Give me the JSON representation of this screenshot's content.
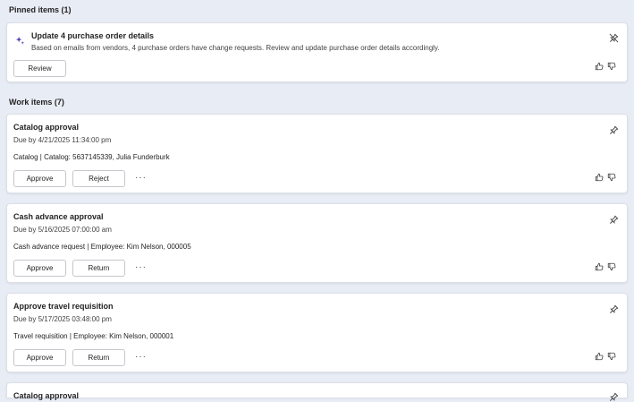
{
  "pinned": {
    "heading": "Pinned items (1)",
    "item": {
      "title": "Update 4 purchase order details",
      "description": "Based on emails from vendors, 4 purchase orders have change requests. Review and update purchase order details accordingly.",
      "review_label": "Review"
    }
  },
  "work": {
    "heading": "Work items (7)",
    "items": [
      {
        "title": "Catalog approval",
        "due": "Due by 4/21/2025 11:34:00 pm",
        "description": "Catalog | Catalog: 5637145339, Julia Funderburk",
        "primary_label": "Approve",
        "secondary_label": "Reject",
        "more_label": "···"
      },
      {
        "title": "Cash advance approval",
        "due": "Due by 5/16/2025 07:00:00 am",
        "description": "Cash advance request | Employee: Kim Nelson, 000005",
        "primary_label": "Approve",
        "secondary_label": "Return",
        "more_label": "···"
      },
      {
        "title": "Approve travel requisition",
        "due": "Due by 5/17/2025 03:48:00 pm",
        "description": "Travel requisition | Employee: Kim Nelson, 000001",
        "primary_label": "Approve",
        "secondary_label": "Return",
        "more_label": "···"
      },
      {
        "title": "Catalog approval"
      }
    ]
  },
  "colors": {
    "background": "#e8ecf5",
    "card": "#ffffff",
    "sparkle": "#4f3fb4",
    "text": "#242424"
  },
  "icons": {
    "sparkle": "sparkle-icon",
    "pin": "pin-icon",
    "unpin": "unpin-icon",
    "like": "thumbs-up-icon",
    "dislike": "thumbs-down-icon"
  }
}
